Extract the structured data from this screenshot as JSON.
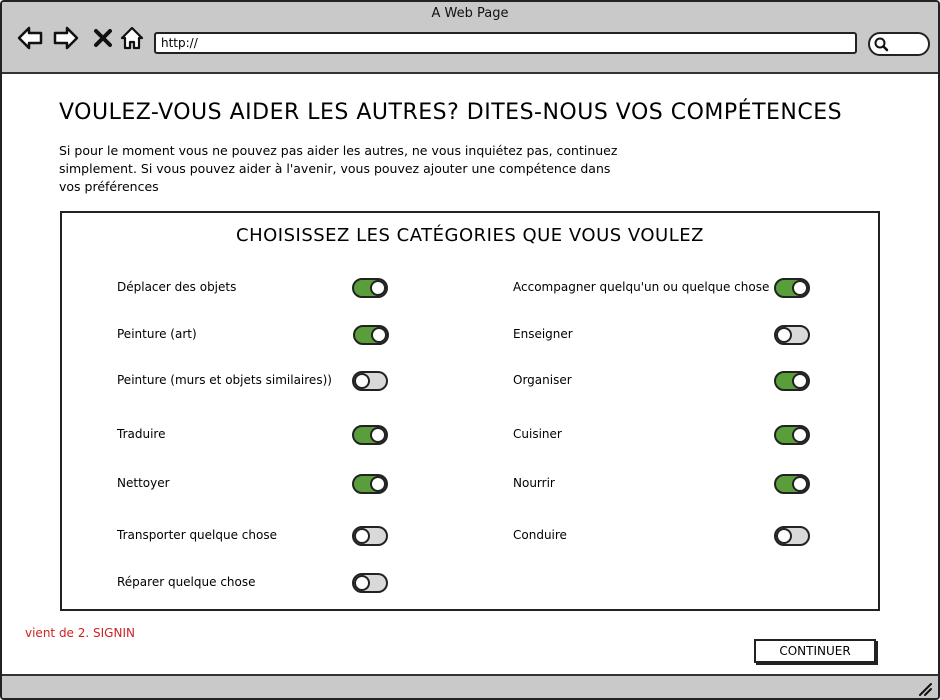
{
  "browser": {
    "window_title": "A Web Page",
    "url": "http://",
    "icons": [
      "back-arrow-icon",
      "forward-arrow-icon",
      "close-icon",
      "home-icon",
      "search-icon",
      "resize-grip-icon"
    ]
  },
  "page": {
    "heading": "VOULEZ-VOUS AIDER LES AUTRES? DITES-NOUS VOS COMPÉTENCES",
    "intro_line1": "Si pour le moment vous ne pouvez pas aider les autres, ne vous inquiétez pas, continuez",
    "intro_line2": "simplement. Si vous pouvez aider à l'avenir, vous pouvez ajouter une compétence dans",
    "intro_line3": "vos préférences"
  },
  "categories": {
    "heading": "CHOISISSEZ LES CATÉGORIES QUE VOUS VOULEZ",
    "toggle_on_color": "#5a9e3c",
    "toggle_off_color": "#d9d9d9",
    "left": [
      {
        "label": "Déplacer des objets",
        "enabled": true
      },
      {
        "label": "Peinture (art)",
        "enabled": true
      },
      {
        "label": "Peinture (murs et objets similaires))",
        "enabled": false
      },
      {
        "label": "Traduire",
        "enabled": true
      },
      {
        "label": "Nettoyer",
        "enabled": true
      },
      {
        "label": "Transporter quelque chose",
        "enabled": false
      },
      {
        "label": "Réparer quelque chose",
        "enabled": false
      }
    ],
    "right": [
      {
        "label": "Accompagner quelqu'un ou quelque chose",
        "enabled": true
      },
      {
        "label": "Enseigner",
        "enabled": false
      },
      {
        "label": "Organiser",
        "enabled": true
      },
      {
        "label": "Cuisiner",
        "enabled": true
      },
      {
        "label": "Nourrir",
        "enabled": true
      },
      {
        "label": "Conduire",
        "enabled": false
      }
    ]
  },
  "footer": {
    "origin_note": "vient de 2. SIGNIN",
    "origin_note_color": "#cc2222",
    "continue_label": "CONTINUER"
  }
}
